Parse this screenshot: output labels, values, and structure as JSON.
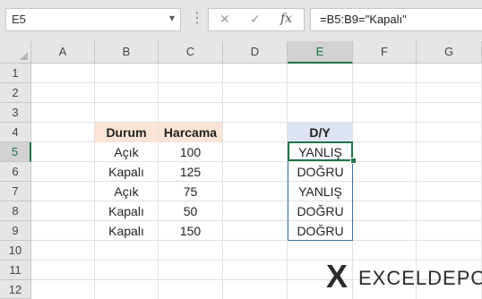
{
  "formula_bar": {
    "name_box": "E5",
    "cancel_icon": "✕",
    "enter_icon": "✓",
    "fx_label": "fx",
    "formula": "=B5:B9=\"Kapalı\""
  },
  "columns": [
    "A",
    "B",
    "C",
    "D",
    "E",
    "F",
    "G"
  ],
  "rows": [
    "1",
    "2",
    "3",
    "4",
    "5",
    "6",
    "7",
    "8",
    "9",
    "10",
    "11",
    "12"
  ],
  "selected_cell": "E5",
  "table": {
    "header_durum": "Durum",
    "header_harcama": "Harcama",
    "header_dy": "D/Y",
    "data": [
      {
        "durum": "Açık",
        "harcama": "100",
        "dy": "YANLIŞ"
      },
      {
        "durum": "Kapalı",
        "harcama": "125",
        "dy": "DOĞRU"
      },
      {
        "durum": "Açık",
        "harcama": "75",
        "dy": "YANLIŞ"
      },
      {
        "durum": "Kapalı",
        "harcama": "50",
        "dy": "DOĞRU"
      },
      {
        "durum": "Kapalı",
        "harcama": "150",
        "dy": "DOĞRU"
      }
    ]
  },
  "logo": {
    "mark": "X",
    "text": "EXCELDEPO"
  },
  "colors": {
    "accent_green": "#217346",
    "header_orange": "#fce4d6",
    "header_blue": "#dde3f2"
  }
}
